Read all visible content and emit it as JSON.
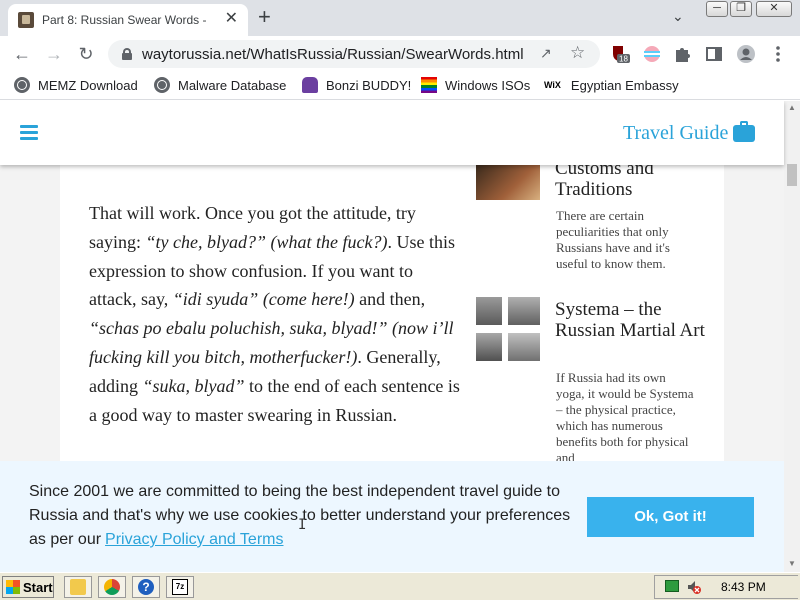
{
  "browser": {
    "tab_title": "Part 8: Russian Swear Words -",
    "tab_close": "✕",
    "new_tab": "+",
    "url": "waytorussia.net/WhatIsRussia/Russian/SwearWords.html",
    "extension_badge": "18"
  },
  "bookmarks": [
    {
      "label": "MEMZ Download",
      "icon": "globe-icon"
    },
    {
      "label": "Malware Database",
      "icon": "globe-icon"
    },
    {
      "label": "Bonzi BUDDY!",
      "icon": "bonzi-icon"
    },
    {
      "label": "Windows ISOs",
      "icon": "rainbow-flag-icon"
    },
    {
      "label": "Egyptian Embassy",
      "icon": "wix-icon",
      "icon_text": "WiX"
    }
  ],
  "site": {
    "brand": "Travel Guide",
    "brand_color": "#2aa3d9"
  },
  "article": {
    "p1": "That will work. Once you got the attitude, try saying: ",
    "p1_q1": "“ty che, blyad?” (what the fuck?)",
    "p2": ". Use this expression to show confusion. If you want to attack, say, ",
    "p2_q": "“idi syuda” (come here!)",
    "p3": " and then, ",
    "p3_q": "“schas po ebalu poluchish, suka, blyad!” (now i’ll fucking kill you bitch, motherfucker!)",
    "p4": ". Generally, adding ",
    "p4_q": "“suka, blyad”",
    "p5": " to the end of each sentence is a good way to master swearing in Russian."
  },
  "sidebar": {
    "item1": {
      "title": "Customs and Traditions",
      "desc": "There are certain peculiarities that only Russians have and it's useful to know them."
    },
    "item2": {
      "title": "Systema – the Russian Martial Art",
      "desc": "If Russia had its own yoga, it would be Systema – the physical practice, which has numerous benefits both for physical and"
    }
  },
  "cookie": {
    "text": "Since 2001 we are committed to being the best independent travel guide to Russia and that's why we use cookies to better understand your preferences as per our",
    "link": "Privacy Policy and Terms",
    "button": "Ok, Got it!",
    "button_color": "#39b2ed"
  },
  "taskbar": {
    "start": "Start",
    "clock": "8:43 PM"
  }
}
